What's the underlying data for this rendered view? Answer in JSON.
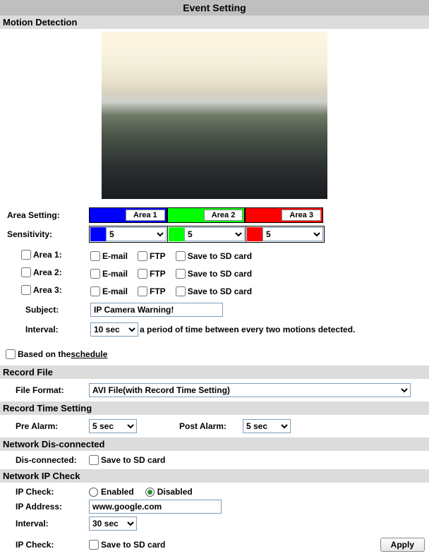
{
  "title": "Event Setting",
  "motion": {
    "header": "Motion Detection",
    "areaSettingLabel": "Area Setting:",
    "areas": [
      {
        "label": "Area 1",
        "color": "#0000ff"
      },
      {
        "label": "Area 2",
        "color": "#00ff00"
      },
      {
        "label": "Area 3",
        "color": "#ff0000"
      }
    ],
    "sensitivityLabel": "Sensitivity:",
    "sensitivity": [
      "5",
      "5",
      "5"
    ],
    "areaRows": [
      {
        "name": "Area 1:",
        "email": "E-mail",
        "ftp": "FTP",
        "sd": "Save to SD card"
      },
      {
        "name": "Area 2:",
        "email": "E-mail",
        "ftp": "FTP",
        "sd": "Save to SD card"
      },
      {
        "name": "Area 3:",
        "email": "E-mail",
        "ftp": "FTP",
        "sd": "Save to SD card"
      }
    ],
    "subjectLabel": "Subject:",
    "subjectValue": "IP Camera Warning!",
    "intervalLabel": "Interval:",
    "intervalValue": "10 sec",
    "intervalHint": "a period of time between every two motions detected.",
    "basedOnPrefix": "Based on the ",
    "basedOnLink": "schedule"
  },
  "recordFile": {
    "header": "Record File",
    "fileFormatLabel": "File Format:",
    "fileFormatValue": "AVI File(with Record Time Setting)"
  },
  "recordTime": {
    "header": "Record Time Setting",
    "preAlarmLabel": "Pre Alarm:",
    "preAlarmValue": "5 sec",
    "postAlarmLabel": "Post Alarm:",
    "postAlarmValue": "5 sec"
  },
  "netDisc": {
    "header": "Network Dis-connected",
    "label": "Dis-connected:",
    "sd": "Save to SD card"
  },
  "ipcheck": {
    "header": "Network IP Check",
    "ipCheckLabel": "IP Check:",
    "enabled": "Enabled",
    "disabled": "Disabled",
    "selected": "disabled",
    "ipAddressLabel": "IP Address:",
    "ipAddressValue": "www.google.com",
    "intervalLabel": "Interval:",
    "intervalValue": "30 sec",
    "ipCheck2Label": "IP Check:",
    "sd": "Save to SD card",
    "apply": "Apply"
  }
}
